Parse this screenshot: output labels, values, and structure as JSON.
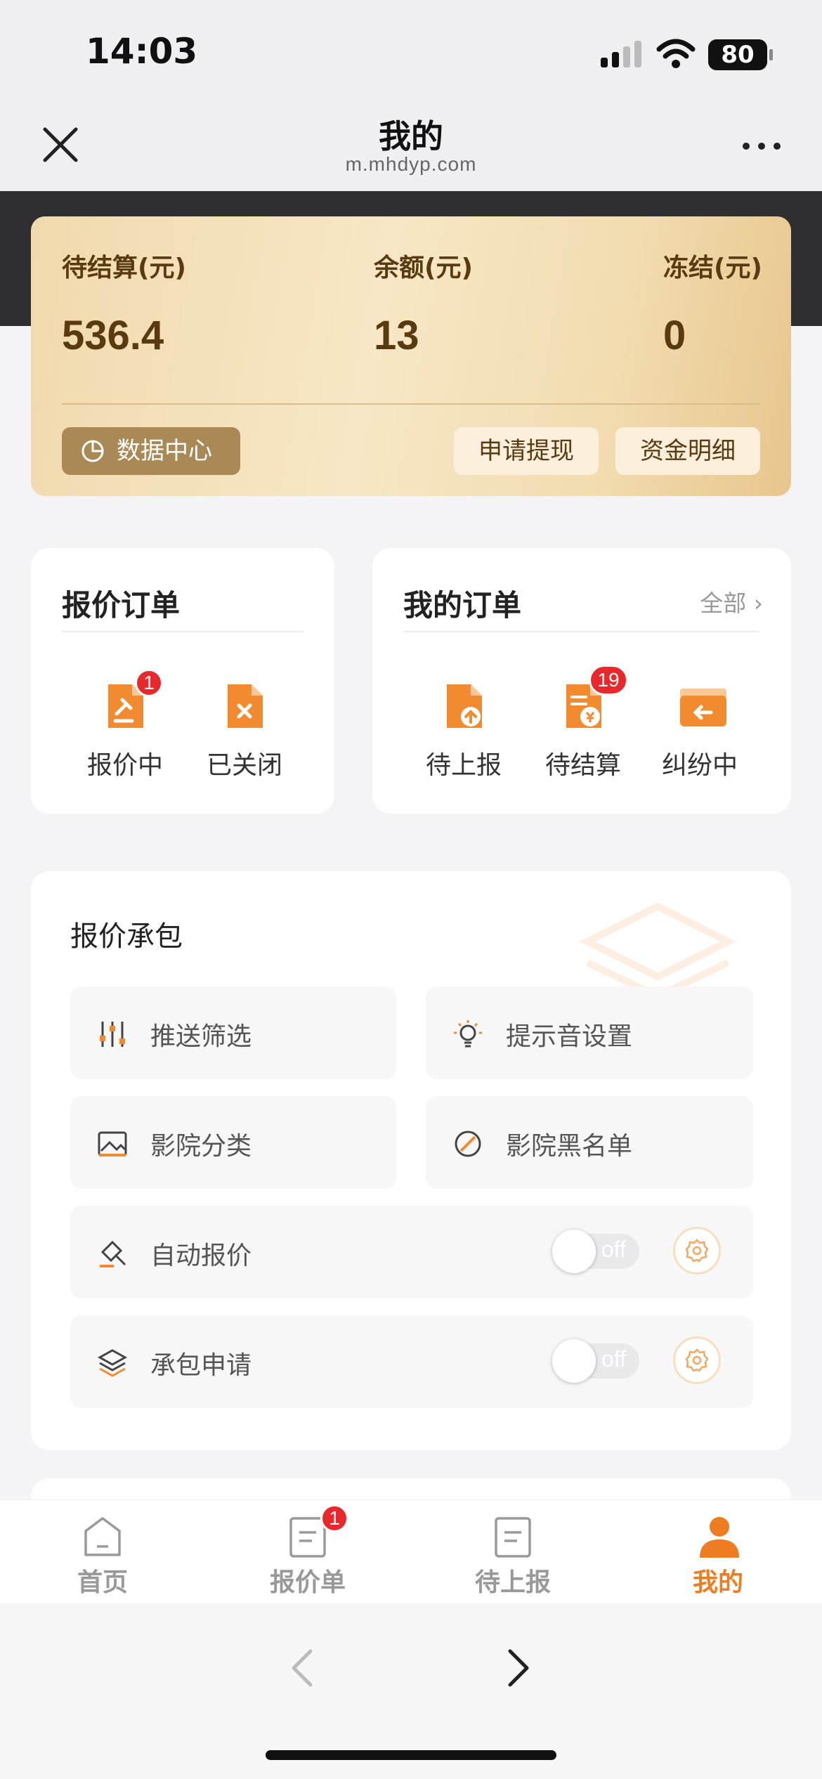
{
  "status_bar": {
    "time": "14:03",
    "battery": "80"
  },
  "nav": {
    "title": "我的",
    "url": "m.mhdyp.com"
  },
  "wallet": {
    "pending_label": "待结算(元)",
    "pending_value": "536.4",
    "balance_label": "余额(元)",
    "balance_value": "13",
    "frozen_label": "冻结(元)",
    "frozen_value": "0",
    "data_center": "数据中心",
    "withdraw": "申请提现",
    "details": "资金明细"
  },
  "quote_orders": {
    "title": "报价订单",
    "items": [
      {
        "label": "报价中",
        "icon": "quote-doc-icon",
        "badge": "1"
      },
      {
        "label": "已关闭",
        "icon": "closed-doc-icon"
      }
    ]
  },
  "my_orders": {
    "title": "我的订单",
    "all": "全部",
    "items": [
      {
        "label": "待上报",
        "icon": "upload-doc-icon"
      },
      {
        "label": "待结算",
        "icon": "settle-doc-icon",
        "badge": "19"
      },
      {
        "label": "纠纷中",
        "icon": "dispute-box-icon"
      }
    ]
  },
  "contract": {
    "title": "报价承包",
    "tiles": [
      {
        "label": "推送筛选",
        "icon": "filter-sliders-icon"
      },
      {
        "label": "提示音设置",
        "icon": "bulb-icon"
      },
      {
        "label": "影院分类",
        "icon": "image-icon"
      },
      {
        "label": "影院黑名单",
        "icon": "ban-icon"
      }
    ],
    "toggles": [
      {
        "label": "自动报价",
        "icon": "gavel-icon",
        "state": "off"
      },
      {
        "label": "承包申请",
        "icon": "layers-icon",
        "state": "off"
      }
    ]
  },
  "tabbar": {
    "items": [
      {
        "label": "首页",
        "icon": "home-icon"
      },
      {
        "label": "报价单",
        "icon": "quote-list-icon",
        "badge": "1"
      },
      {
        "label": "待上报",
        "icon": "pending-list-icon"
      },
      {
        "label": "我的",
        "icon": "user-icon",
        "active": true
      }
    ]
  },
  "colors": {
    "accent": "#ee7d22",
    "wallet_text": "#5a3a10",
    "badge": "#e8282b"
  }
}
